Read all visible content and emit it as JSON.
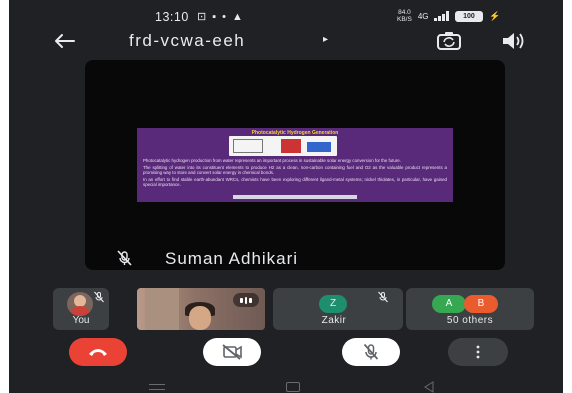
{
  "status_bar": {
    "time": "13:10",
    "notification_icons": [
      "cast-icon",
      "message-icon",
      "dot-icon",
      "alert-icon"
    ],
    "net_speed_value": "84.0",
    "net_speed_unit": "KB/S",
    "net_type": "4G",
    "battery": "100"
  },
  "meeting": {
    "code": "frd-vcwa-eeh",
    "caret": "▸"
  },
  "main_tile": {
    "participant_name": "Suman Adhikari",
    "slide": {
      "title": "Photocatalytic Hydrogen Generation",
      "paragraphs": [
        "Photocatalytic hydrogen production from water represents an important process in sustainable solar energy conversion for the future.",
        "The splitting of water into its constituent elements to produce H2 as a clean, non-carbon containing fuel and O2 as the valuable product represents a promising way to store and convert solar energy in chemical bonds.",
        "In an effort to find stable earth-abundant WRCs, chemists have been exploring different ligand-metal systems; nickel thiolates, in particular, have gained special importance."
      ]
    }
  },
  "thumbnails": {
    "you_label": "You",
    "zakir_initial": "Z",
    "zakir_label": "Zakir",
    "others_initials": [
      "A",
      "B"
    ],
    "others_label": "50 others"
  },
  "colors": {
    "background": "#202124",
    "end_call": "#ea4335",
    "slide_purple": "#5a2a7a",
    "avatar_z": "#1e8e6e",
    "avatar_a": "#36a852",
    "avatar_b": "#ea5b2e"
  }
}
